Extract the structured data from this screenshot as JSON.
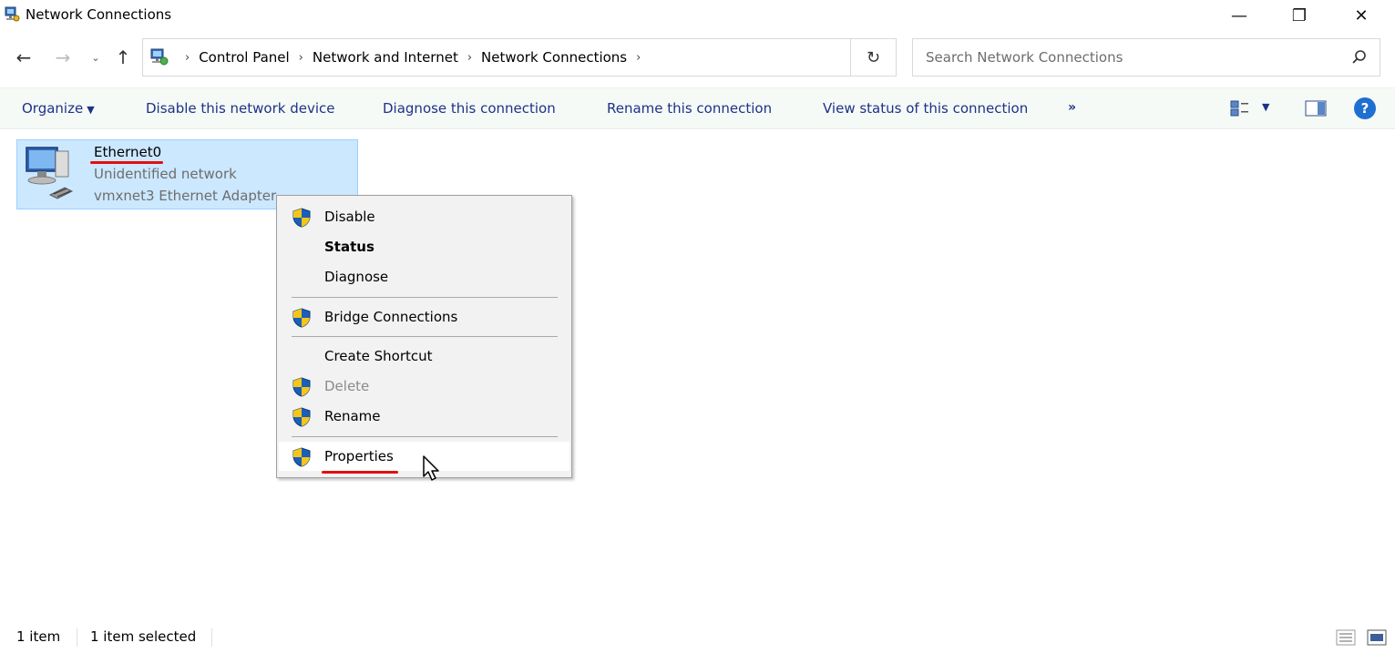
{
  "window": {
    "title": "Network Connections",
    "controls": {
      "minimize": "—",
      "maximize": "❐",
      "close": "✕"
    }
  },
  "address": {
    "breadcrumbs": [
      "Control Panel",
      "Network and Internet",
      "Network Connections"
    ],
    "search_placeholder": "Search Network Connections"
  },
  "toolbar": {
    "organize": "Organize",
    "disable": "Disable this network device",
    "diagnose": "Diagnose this connection",
    "rename": "Rename this connection",
    "view_status": "View status of this connection",
    "more": "»",
    "help": "?"
  },
  "item": {
    "name": "Ethernet0",
    "status": "Unidentified network",
    "adapter": "vmxnet3 Ethernet Adapter"
  },
  "context_menu": {
    "items": [
      {
        "label": "Disable",
        "shield": true
      },
      {
        "label": "Status",
        "bold": true
      },
      {
        "label": "Diagnose"
      },
      {
        "label": "Bridge Connections",
        "shield": true
      },
      {
        "label": "Create Shortcut"
      },
      {
        "label": "Delete",
        "shield": true,
        "disabled": true
      },
      {
        "label": "Rename",
        "shield": true
      },
      {
        "label": "Properties",
        "shield": true,
        "highlighted": true
      }
    ]
  },
  "statusbar": {
    "count": "1 item",
    "selected": "1 item selected"
  },
  "colors": {
    "selection_fill": "#cce8ff",
    "link_blue": "#1e3287",
    "annotation_red": "#e01010"
  }
}
